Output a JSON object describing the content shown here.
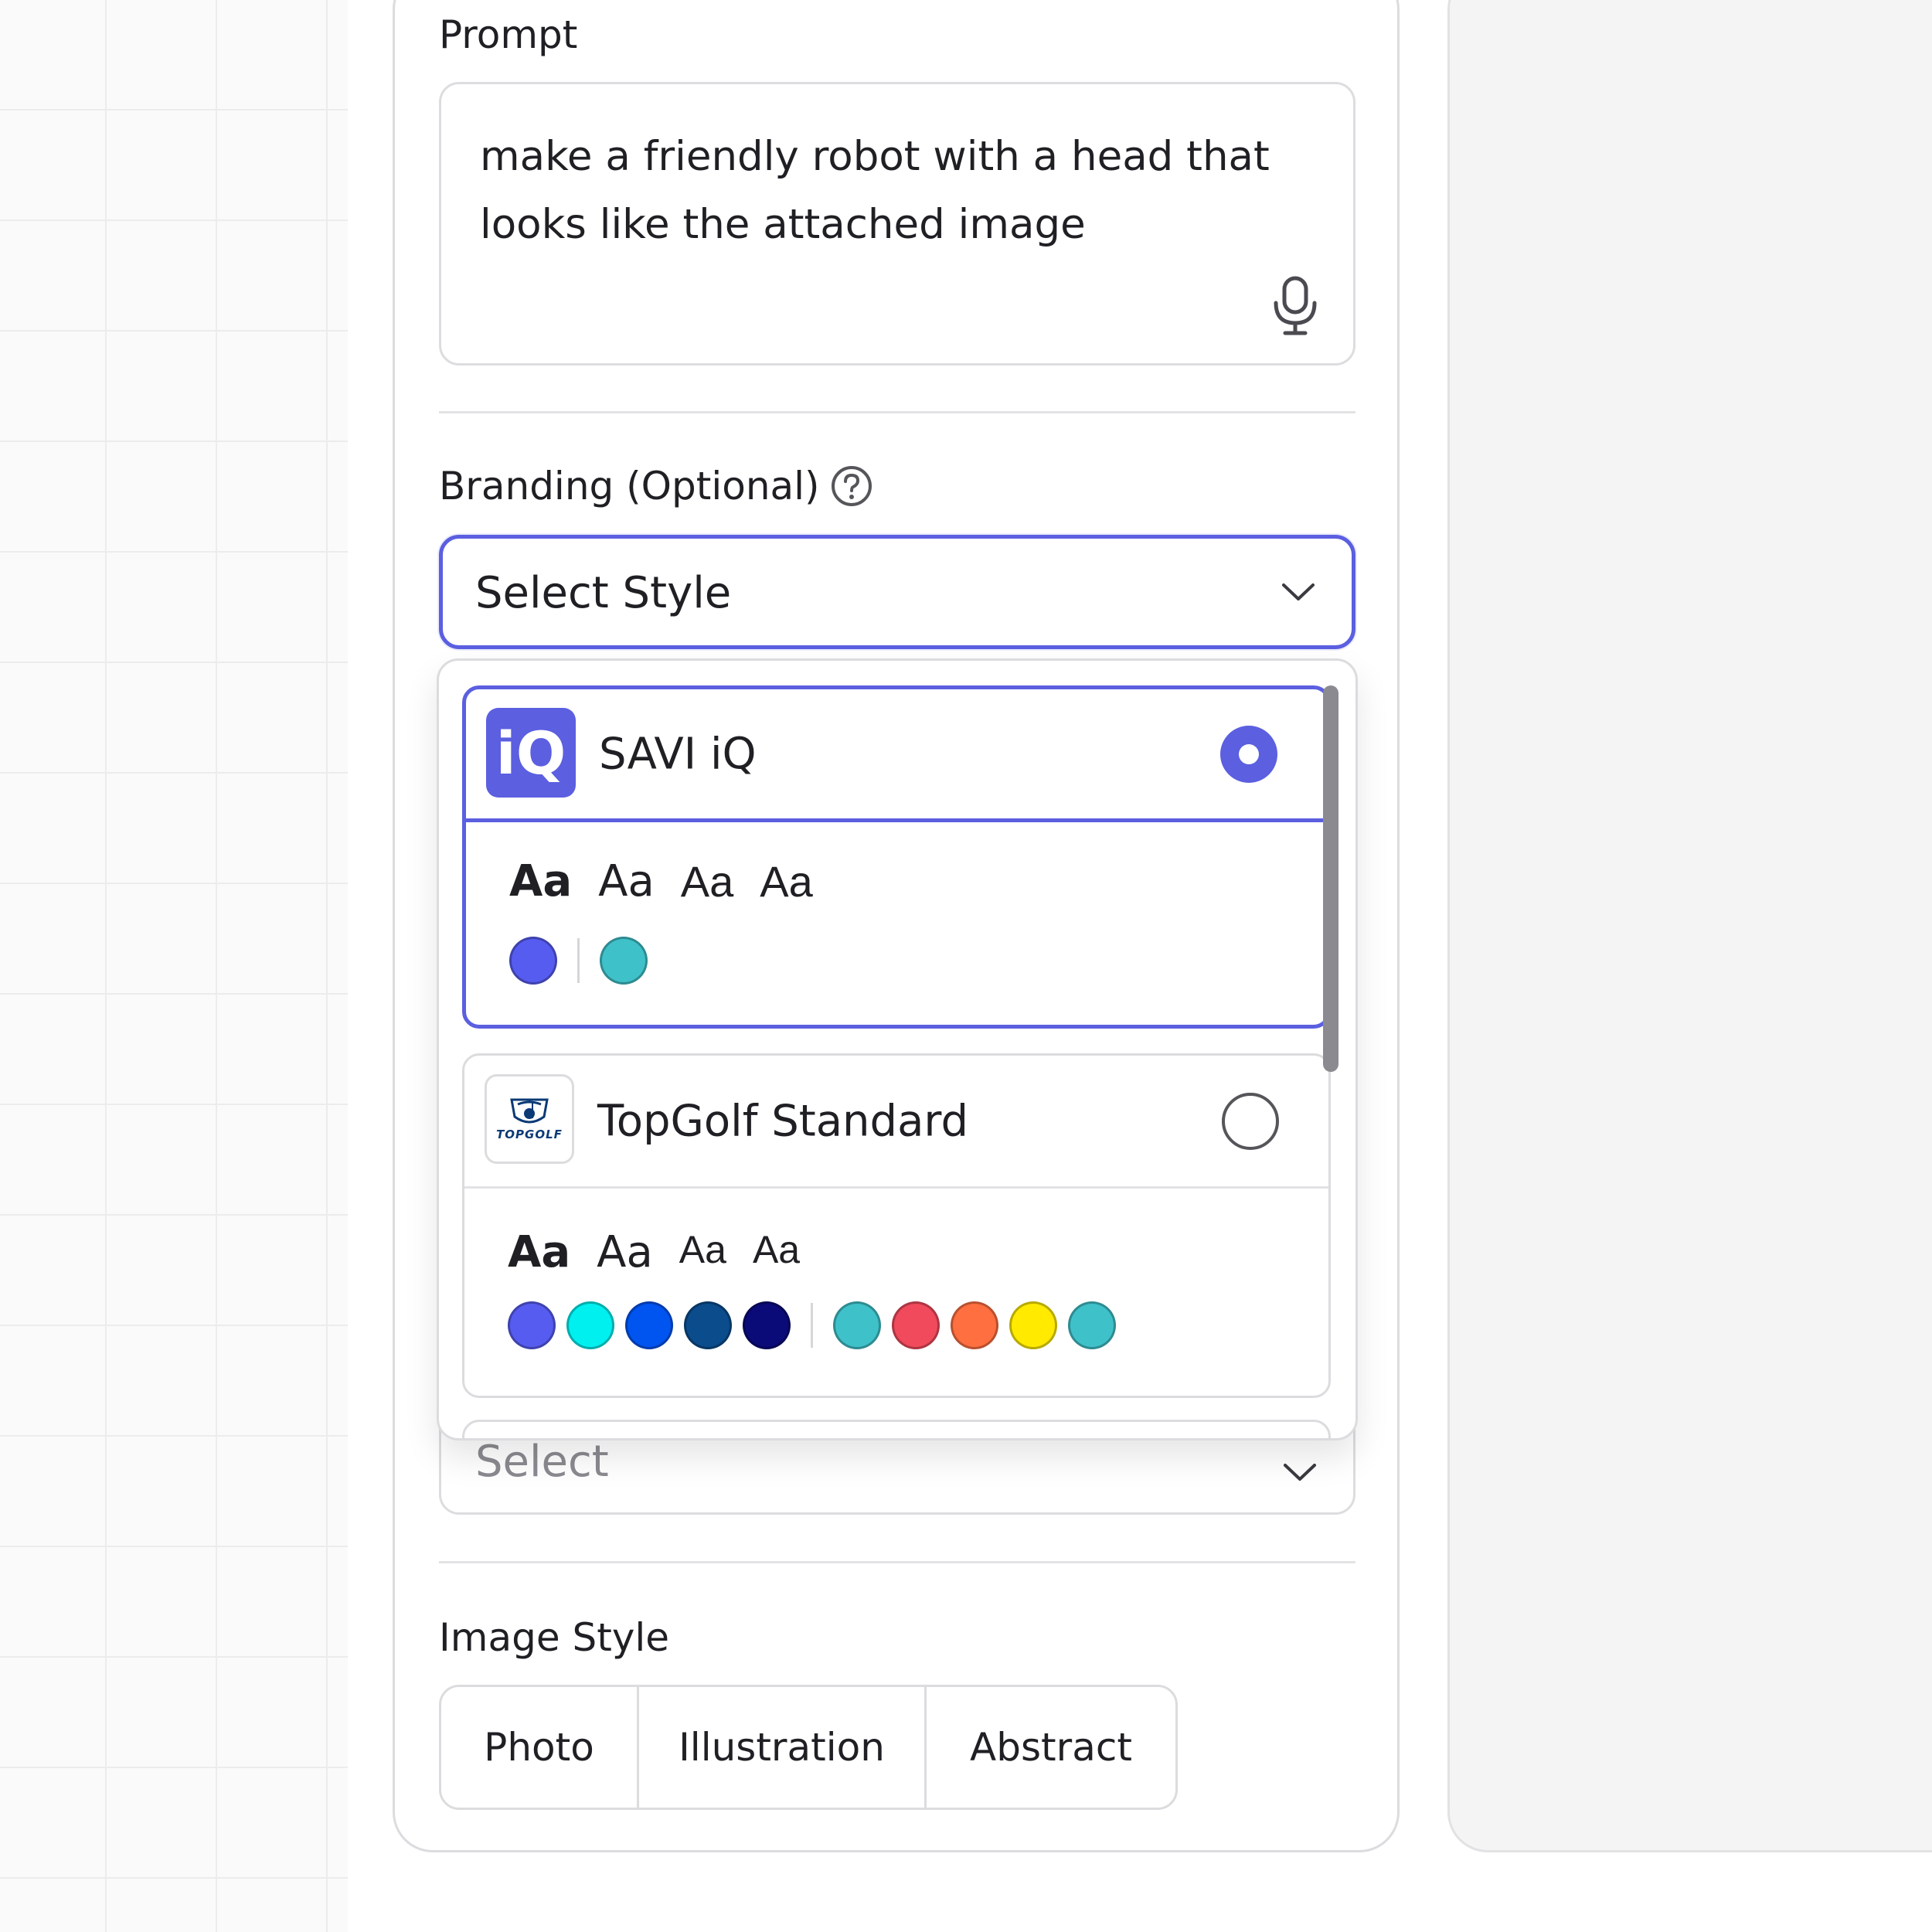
{
  "prompt": {
    "label": "Prompt",
    "value": "make a friendly robot with a head that looks like the attached image",
    "mic_icon": "microphone-icon"
  },
  "branding": {
    "label": "Branding (Optional)",
    "help_icon": "question-circle-icon",
    "select_value": "Select Style",
    "options": [
      {
        "name": "SAVI iQ",
        "logo_text": "iQ",
        "selected": true,
        "font_samples": [
          "Aa",
          "Aa",
          "Aa",
          "Aa"
        ],
        "primary_colors": [
          "#575CF0"
        ],
        "secondary_colors": [
          "#3FC1C9"
        ]
      },
      {
        "name": "TopGolf Standard",
        "logo_text": "TOPGOLF",
        "selected": false,
        "font_samples": [
          "Aa",
          "Aa",
          "Aa",
          "Aa"
        ],
        "primary_colors": [
          "#575CF0",
          "#00F0F0",
          "#0054F0",
          "#0B4C8C",
          "#0A0A78"
        ],
        "secondary_colors": [
          "#3FC1C9",
          "#F04A5C",
          "#FF6F40",
          "#FFEA00",
          "#3FC1C9"
        ]
      }
    ]
  },
  "second_select": {
    "value": "Select"
  },
  "image_style": {
    "label": "Image Style",
    "options": [
      "Photo",
      "Illustration",
      "Abstract"
    ]
  },
  "colors": {
    "accent": "#5B5FE0",
    "border": "#DCDCDF",
    "text": "#1F1F24"
  }
}
